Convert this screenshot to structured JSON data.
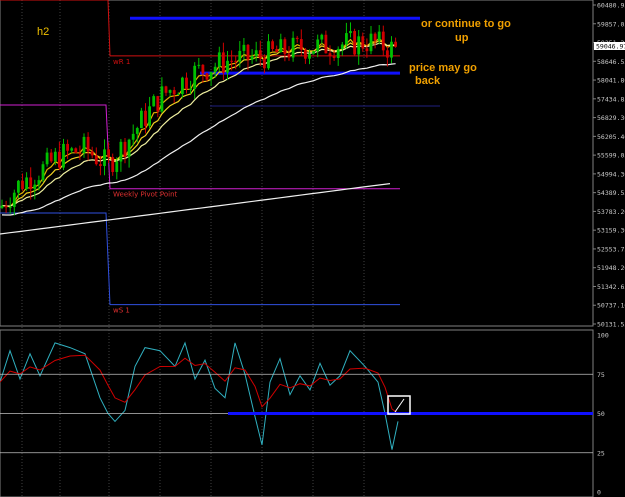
{
  "chart_data": {
    "type": "candlestick",
    "timeframe_label": "h2",
    "price_axis": {
      "ylim": [
        50131.55,
        60480.95
      ],
      "ticks": [
        "60480.95",
        "59857.05",
        "59251.30",
        "58646.55",
        "58041.80",
        "57434.85",
        "56829.30",
        "56205.40",
        "55599.05",
        "54994.30",
        "54389.55",
        "53783.20",
        "53159.30",
        "52553.75",
        "51948.20",
        "51342.65",
        "50737.10",
        "50131.55"
      ],
      "current_price": "59046.97"
    },
    "oscillator_axis": {
      "ylim": [
        0,
        100
      ],
      "ticks": [
        "100",
        "75",
        "50",
        "25",
        "0"
      ]
    },
    "pivot_levels": [
      {
        "name": "wR 1",
        "price": 58830,
        "color": "#d01010"
      },
      {
        "name": "Weekly Pivot Point",
        "price": 54520,
        "color": "#d020d0"
      },
      {
        "name": "wS 1",
        "price": 50760,
        "color": "#3050e0"
      }
    ],
    "drawn_levels": [
      {
        "price": 60050,
        "color": "#1010ff"
      },
      {
        "price": 58270,
        "color": "#1010ff"
      }
    ],
    "oscillator_level": {
      "value": 50,
      "color": "#1010ff"
    },
    "annotations": [
      {
        "text": "or continue to go up"
      },
      {
        "text": "price may go back"
      }
    ],
    "colors": {
      "bull": "#00c000",
      "bear": "#d00000",
      "ema_fast": "#e0b000",
      "ema_slow": "#f0f0a0",
      "ma_long": "#f0f0f0",
      "osc_main": "#30b0c0",
      "osc_signal": "#d00000"
    }
  }
}
